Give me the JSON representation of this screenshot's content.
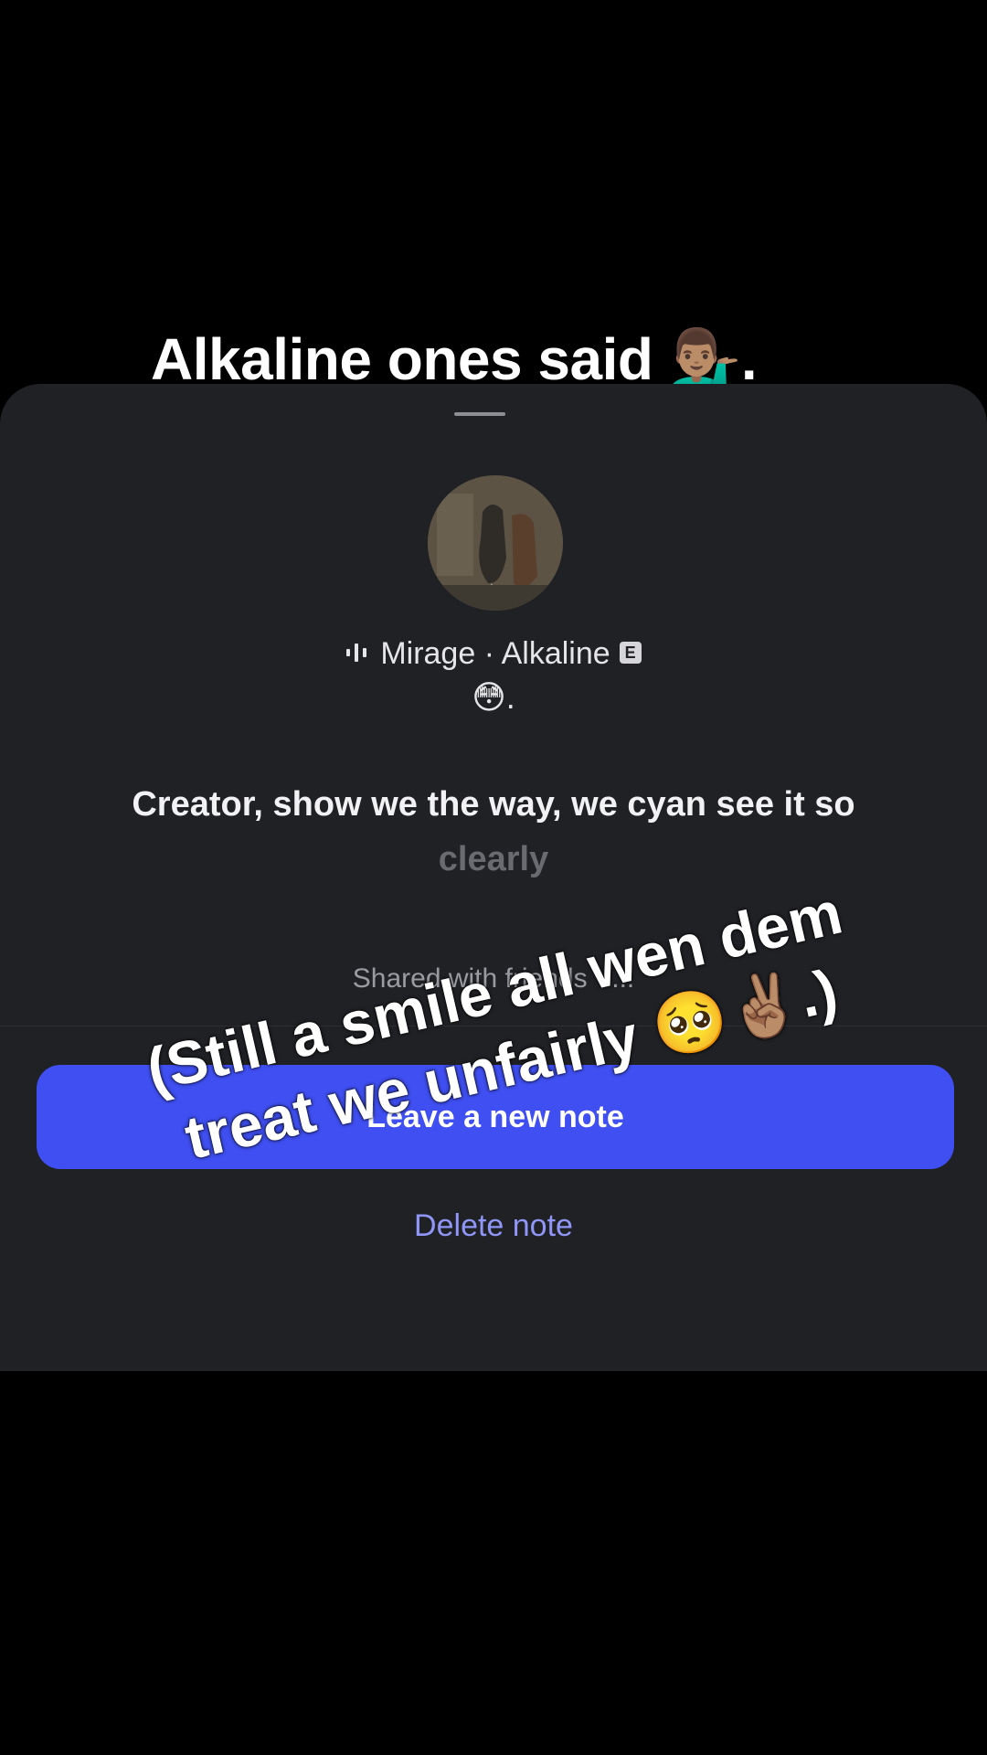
{
  "top_caption": "Alkaline ones said 💁🏽‍♂️.",
  "sheet": {
    "track": {
      "song": "Mirage",
      "separator": "·",
      "artist": "Alkaline",
      "explicit_badge": "E"
    },
    "note_emoji": "😳.",
    "lyric": {
      "main": "Creator, show we the way, we cyan see it so",
      "faded": "clearly"
    },
    "shared_text": "Shared with friends · ...",
    "primary_button_label": "Leave a new note",
    "delete_label": "Delete note"
  },
  "overlay_caption": "(Still a smile all wen dem treat we unfairly 🥺✌🏽.)",
  "colors": {
    "sheet_bg": "#202125",
    "primary_button": "#3f4ff1",
    "delete_link": "#8f96f7"
  }
}
